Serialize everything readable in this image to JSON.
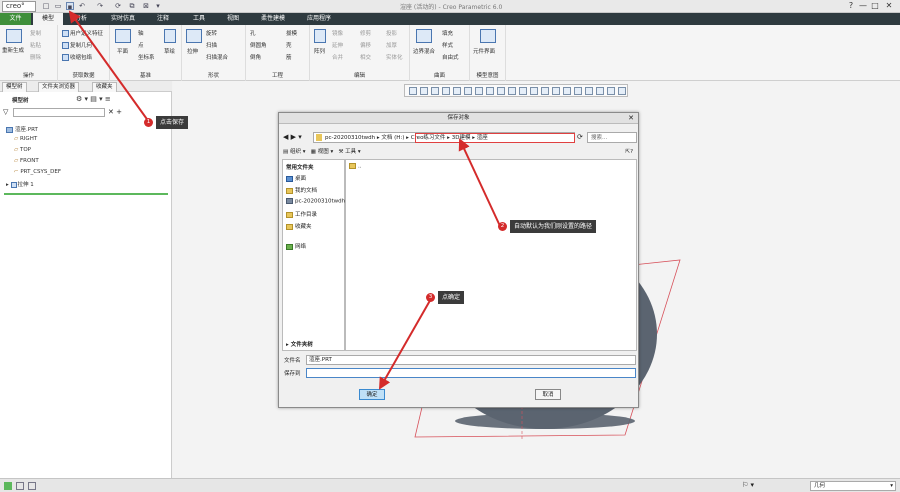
{
  "titlebar": {
    "logo": "creo°",
    "title": "渲座 (活动的) - Creo Parametric 6.0",
    "controls": [
      "?",
      "—",
      "□",
      "✕"
    ]
  },
  "tabs": [
    {
      "label": "文件",
      "state": "file"
    },
    {
      "label": "模型",
      "state": "active"
    },
    {
      "label": "分析"
    },
    {
      "label": "实时仿真"
    },
    {
      "label": "注释"
    },
    {
      "label": "工具"
    },
    {
      "label": "视图"
    },
    {
      "label": "柔性建模"
    },
    {
      "label": "应用程序"
    }
  ],
  "ribbon": {
    "groups": [
      "操作",
      "获取数据",
      "基准",
      "形状",
      "工程",
      "编辑",
      "曲面",
      "模型意图"
    ],
    "items": {
      "regen": "重新生成",
      "copy": "复制",
      "paste": "粘贴",
      "delete": "删除",
      "udf": "用户定义特征",
      "copy_geom": "复制几何",
      "shrinkwrap": "收缩包络",
      "plane": "平面",
      "axis": "轴",
      "point": "点",
      "csys": "坐标系",
      "sketch": "草绘",
      "extrude": "拉伸",
      "revolve": "旋转",
      "sweep": "扫描",
      "swept_blend": "扫描混合",
      "hole": "孔",
      "round": "倒圆角",
      "chamfer": "倒角",
      "draft": "拔模",
      "shell": "壳",
      "rib": "筋",
      "pattern": "阵列",
      "mirror": "镜像",
      "extend": "延伸",
      "project": "投影",
      "trim": "修剪",
      "offset": "偏移",
      "thicken": "加厚",
      "merge": "合并",
      "intersect": "相交",
      "solidify": "实体化",
      "boundary_blend": "边界混合",
      "fill": "填充",
      "style": "样式",
      "freestyle": "自由式",
      "component_interface": "元件界面"
    }
  },
  "left_tabs": [
    "模型树",
    "文件夹浏览器",
    "收藏夹"
  ],
  "model_tree": {
    "header": "模型树",
    "items": [
      "渲座.PRT",
      "RIGHT",
      "TOP",
      "FRONT",
      "PRT_CSYS_DEF",
      "拉伸 1"
    ]
  },
  "dialog": {
    "title": "保存对象",
    "path": [
      "pc-20200310twdh",
      "文档 (H:)",
      "Creo练习文件",
      "3D建模",
      "渲座"
    ],
    "search_placeholder": "搜索...",
    "toolbar": {
      "organize": "组织",
      "views": "视图",
      "tools": "工具"
    },
    "nav_header": "常用文件夹",
    "nav_items": [
      "桌面",
      "我的文档",
      "pc-20200310twdh",
      "工作目录",
      "收藏夹",
      "网络"
    ],
    "folder_tree": "文件夹树",
    "files": [
      ".."
    ],
    "filename_label": "文件名",
    "filename": "渲座.PRT",
    "saveto_label": "保存到",
    "saveto": "",
    "ok": "确定",
    "cancel": "取消"
  },
  "status": {
    "filter": "几何"
  },
  "annotations": [
    {
      "num": "1",
      "text": "点击保存"
    },
    {
      "num": "2",
      "text": "自动默认为我们刚设置的路径"
    },
    {
      "num": "3",
      "text": "点确定"
    }
  ],
  "colors": {
    "tabbar": "#2e3a3f",
    "file_tab": "#3f8f3a",
    "callout": "#3b3b3b",
    "arrow": "#d42b2b",
    "part": "#5b6470"
  }
}
